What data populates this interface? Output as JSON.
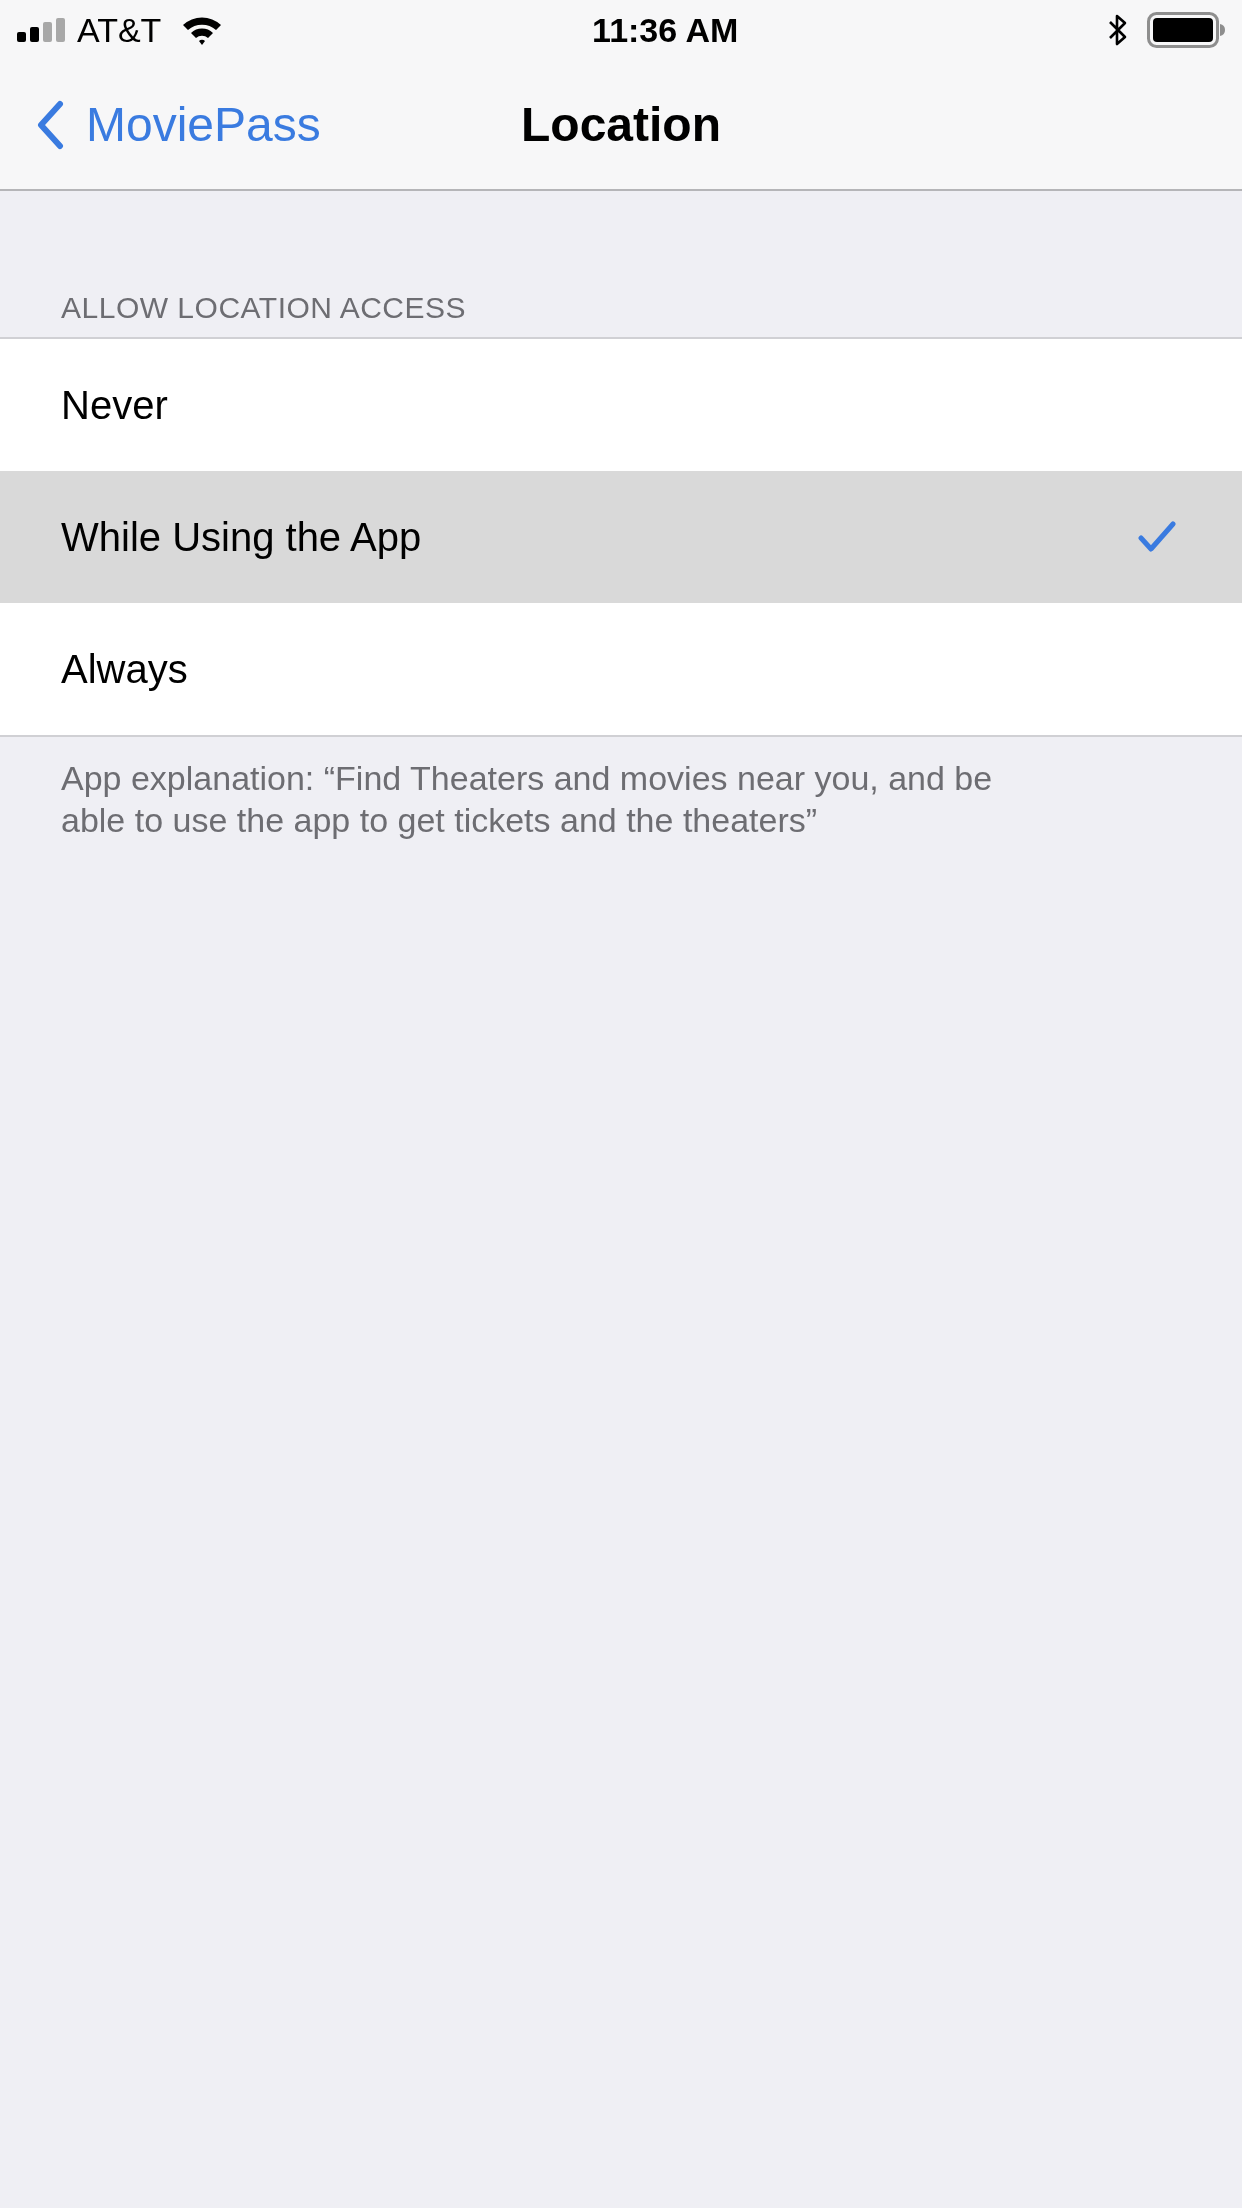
{
  "status_bar": {
    "carrier": "AT&T",
    "time": "11:36 AM"
  },
  "nav_bar": {
    "back_label": "MoviePass",
    "title": "Location"
  },
  "section": {
    "header": "ALLOW LOCATION ACCESS",
    "options": [
      {
        "label": "Never",
        "selected": false
      },
      {
        "label": "While Using the App",
        "selected": true
      },
      {
        "label": "Always",
        "selected": false
      }
    ],
    "footer": "App explanation: “Find Theaters and movies near you, and be able to use the app to get tickets and the theaters”"
  }
}
